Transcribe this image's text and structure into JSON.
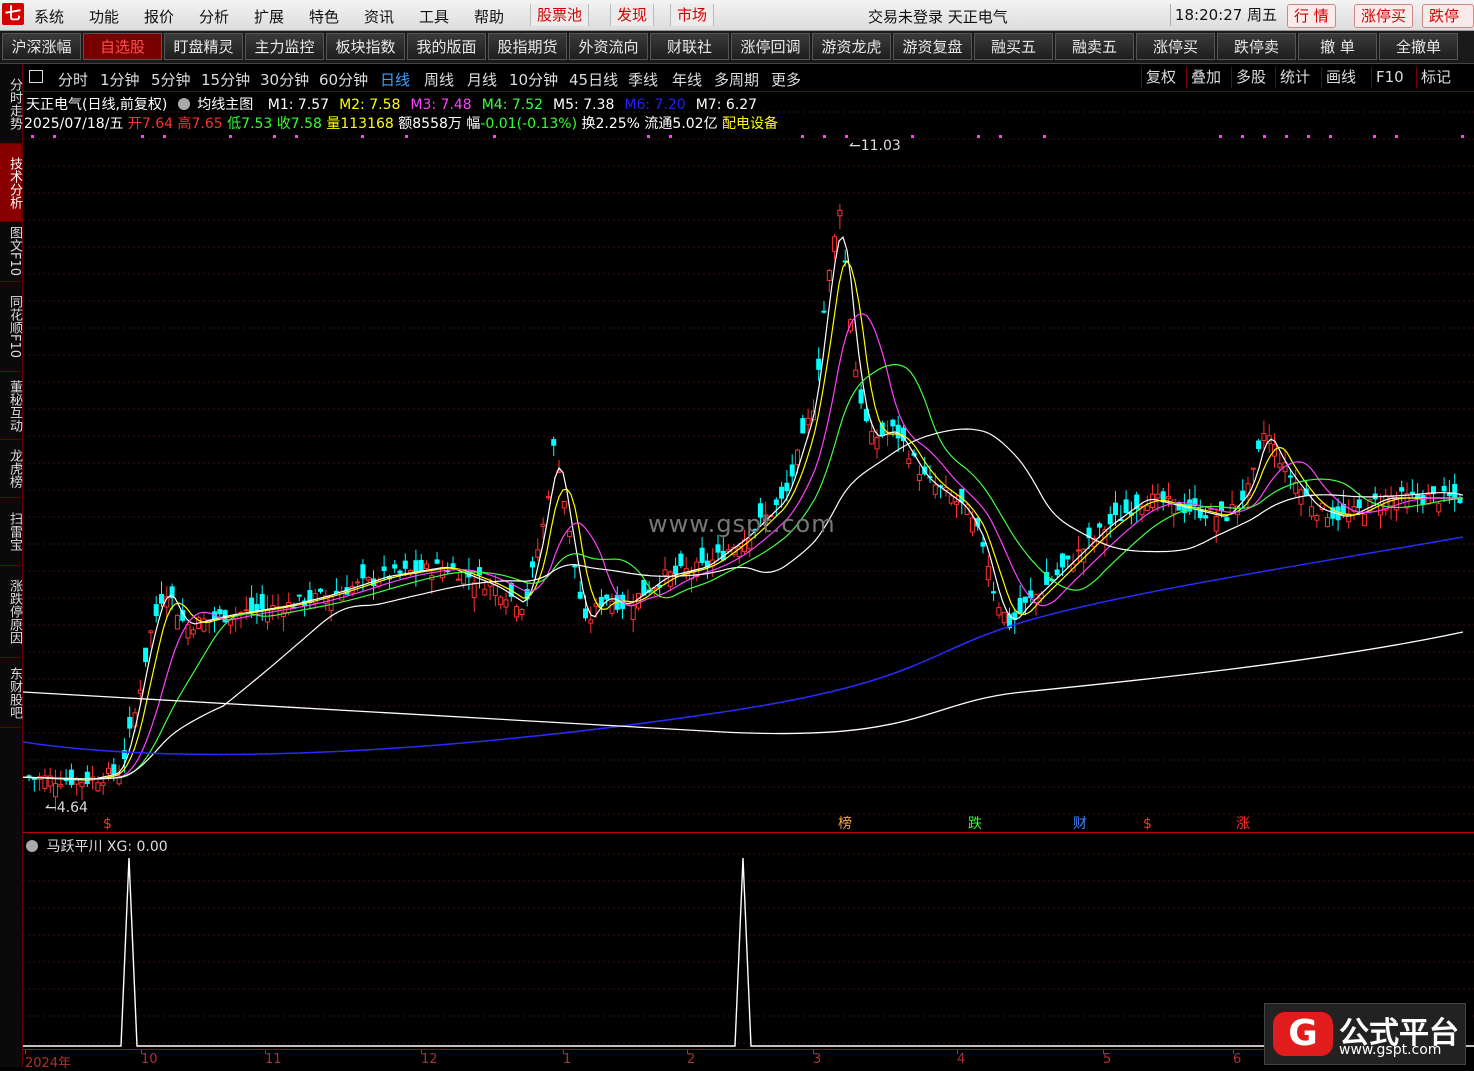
{
  "menu": {
    "logo": "七",
    "items": [
      "系统",
      "功能",
      "报价",
      "分析",
      "扩展",
      "特色",
      "资讯",
      "工具",
      "帮助"
    ],
    "red_items": [
      "股票池",
      "发现",
      "市场"
    ],
    "status": "交易未登录 天正电气",
    "clock": "18:20:27 周五",
    "quick": [
      "行 情",
      "涨停买",
      "跌停买"
    ]
  },
  "toolbar": [
    "沪深涨幅",
    "自选股",
    "盯盘精灵",
    "主力监控",
    "板块指数",
    "我的版面",
    "股指期货",
    "外资流向",
    "财联社",
    "涨停回调",
    "游资龙虎",
    "游资复盘",
    "融买五",
    "融卖五",
    "涨停买",
    "跌停卖",
    "撤 单",
    "全撤单"
  ],
  "sidetabs": [
    "分时走势",
    "技术分析",
    "图文F10",
    "同花顺F10",
    "董秘互动",
    "龙虎榜",
    "扫雷宝",
    "涨跌停原因",
    "东财股吧"
  ],
  "periods": [
    "分时",
    "1分钟",
    "5分钟",
    "15分钟",
    "30分钟",
    "60分钟",
    "日线",
    "周线",
    "月线",
    "10分钟",
    "45日线",
    "季线",
    "年线",
    "多周期",
    "更多"
  ],
  "right_tools": [
    "复权",
    "叠加",
    "多股",
    "统计",
    "画线",
    "F10",
    "标记"
  ],
  "info1": {
    "stock": "天正电气(日线,前复权)",
    "indicator": "均线主图",
    "ma": [
      {
        "label": "M1: 7.57",
        "color": "#ffffff"
      },
      {
        "label": "M2: 7.58",
        "color": "#ffff00"
      },
      {
        "label": "M3: 7.48",
        "color": "#ff40ff"
      },
      {
        "label": "M4: 7.52",
        "color": "#40ff40"
      },
      {
        "label": "M5: 7.38",
        "color": "#ffffff"
      },
      {
        "label": "M6: 7.20",
        "color": "#2020ff"
      },
      {
        "label": "M7: 6.27",
        "color": "#ffffff"
      }
    ]
  },
  "info2": [
    {
      "t": "2025/07/18/五 ",
      "c": "#ffffff"
    },
    {
      "t": "开",
      "c": "#ff3030"
    },
    {
      "t": "7.64 ",
      "c": "#ff3030"
    },
    {
      "t": "高",
      "c": "#ff3030"
    },
    {
      "t": "7.65 ",
      "c": "#ff3030"
    },
    {
      "t": "低",
      "c": "#30ff30"
    },
    {
      "t": "7.53 ",
      "c": "#30ff30"
    },
    {
      "t": "收",
      "c": "#30ff30"
    },
    {
      "t": "7.58 ",
      "c": "#30ff30"
    },
    {
      "t": "量",
      "c": "#ffff00"
    },
    {
      "t": "113168 ",
      "c": "#ffff00"
    },
    {
      "t": "额",
      "c": "#ffffff"
    },
    {
      "t": "8558万 ",
      "c": "#ffffff"
    },
    {
      "t": "幅",
      "c": "#ffffff"
    },
    {
      "t": "-0.01(-0.13%) ",
      "c": "#30ff30"
    },
    {
      "t": "换",
      "c": "#ffffff"
    },
    {
      "t": "2.25% ",
      "c": "#ffffff"
    },
    {
      "t": "流通",
      "c": "#ffffff"
    },
    {
      "t": "5.02亿 ",
      "c": "#ffffff"
    },
    {
      "t": "配电设备",
      "c": "#ffff00"
    }
  ],
  "labels": {
    "high": "11.03",
    "low": "4.64"
  },
  "signals": [
    {
      "t": "$",
      "c": "#ff3030"
    },
    {
      "t": "榜",
      "c": "#ffa040"
    },
    {
      "t": "跌",
      "c": "#30ff30"
    },
    {
      "t": "财",
      "c": "#4080ff"
    },
    {
      "t": "$",
      "c": "#ff3030"
    },
    {
      "t": "涨",
      "c": "#ff3030"
    }
  ],
  "indicator_title": "马跃平川 XG: 0.00",
  "watermark": "www.gspt.com",
  "brand": {
    "logo": "G",
    "name": "公式平台",
    "url": "www.gspt.com"
  },
  "time_axis": [
    "2024年",
    "10",
    "11",
    "12",
    "1",
    "2",
    "3",
    "4",
    "5",
    "6"
  ]
}
